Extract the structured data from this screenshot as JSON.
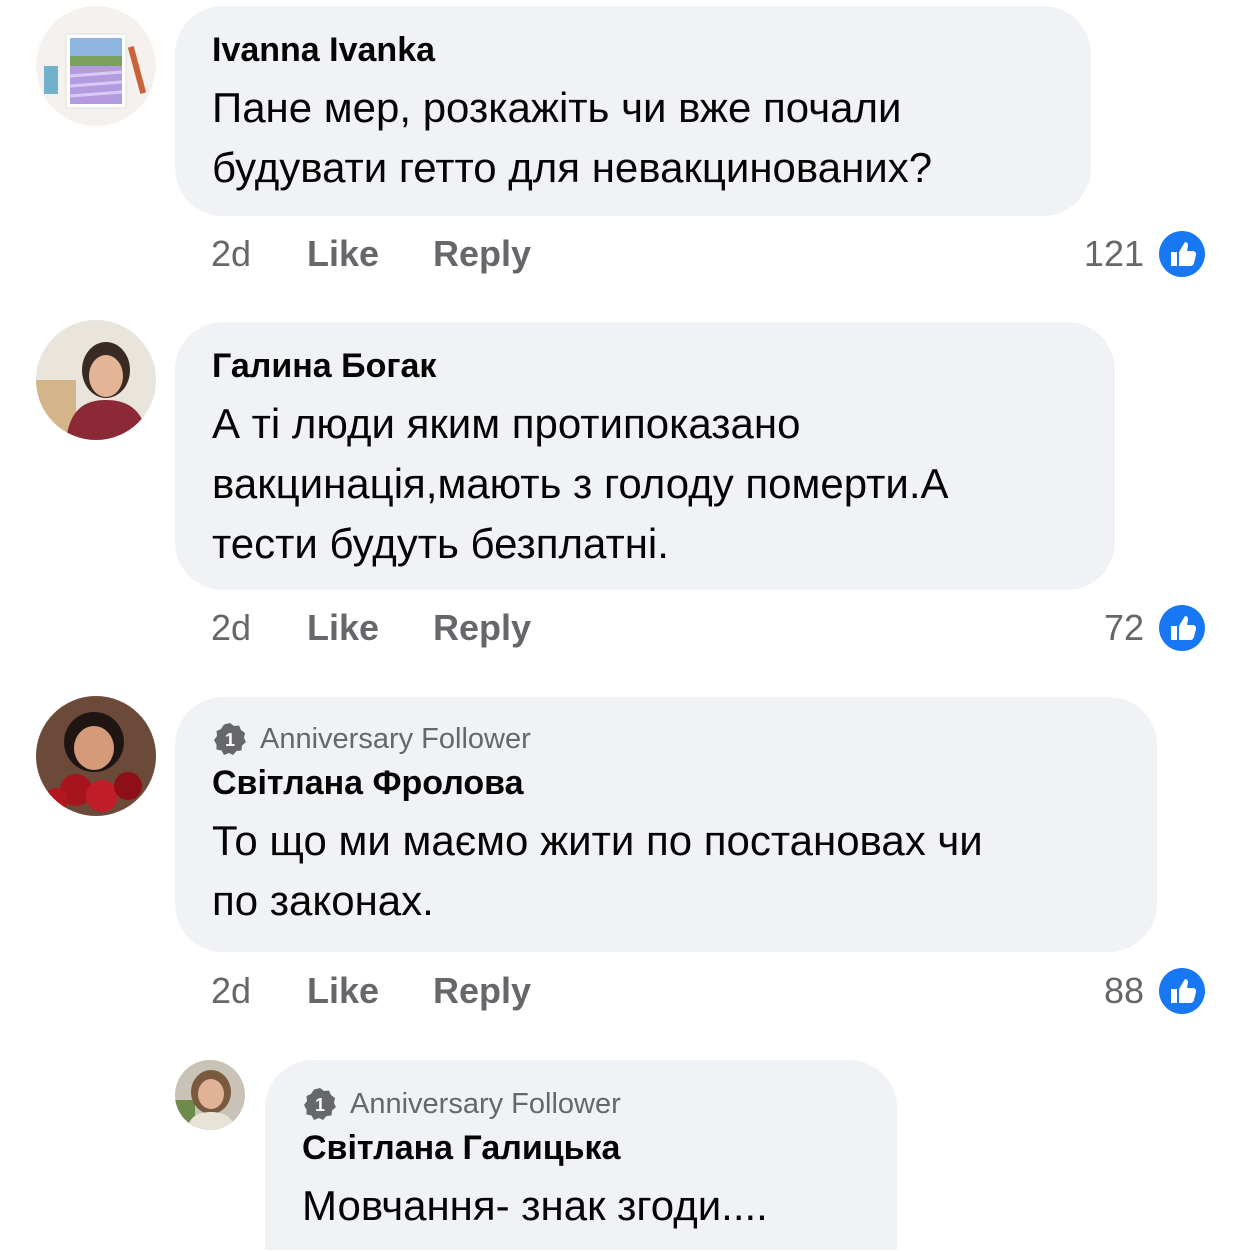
{
  "comments": [
    {
      "author": "Ivanna Ivanka",
      "badge": "",
      "lines": [
        "Пане мер, розкажіть чи вже почали",
        "будувати гетто для невакцинованих?"
      ],
      "time": "2d",
      "like_label": "Like",
      "reply_label": "Reply",
      "reaction_count": "121"
    },
    {
      "author": "Галина Богак",
      "badge": "",
      "lines": [
        "А ті люди яким протипоказано",
        "вакцинація,мають з голоду померти.А",
        "тести будуть безплатні."
      ],
      "time": "2d",
      "like_label": "Like",
      "reply_label": "Reply",
      "reaction_count": "72"
    },
    {
      "author": "Світлана Фролова",
      "badge": "Anniversary Follower",
      "badge_number": "1",
      "lines": [
        "То що ми маємо жити по постановах чи",
        "по законах."
      ],
      "time": "2d",
      "like_label": "Like",
      "reply_label": "Reply",
      "reaction_count": "88"
    },
    {
      "author": "Світлана Галицька",
      "badge": "Anniversary Follower",
      "badge_number": "1",
      "lines": [
        "Мовчання- знак згоди...."
      ]
    }
  ],
  "colors": {
    "bubble": "#f0f2f5",
    "muted_text": "#65676b",
    "like_blue": "#1877f2"
  },
  "icons": {
    "like": "thumbs-up-icon",
    "badge": "anniversary-badge-icon"
  }
}
